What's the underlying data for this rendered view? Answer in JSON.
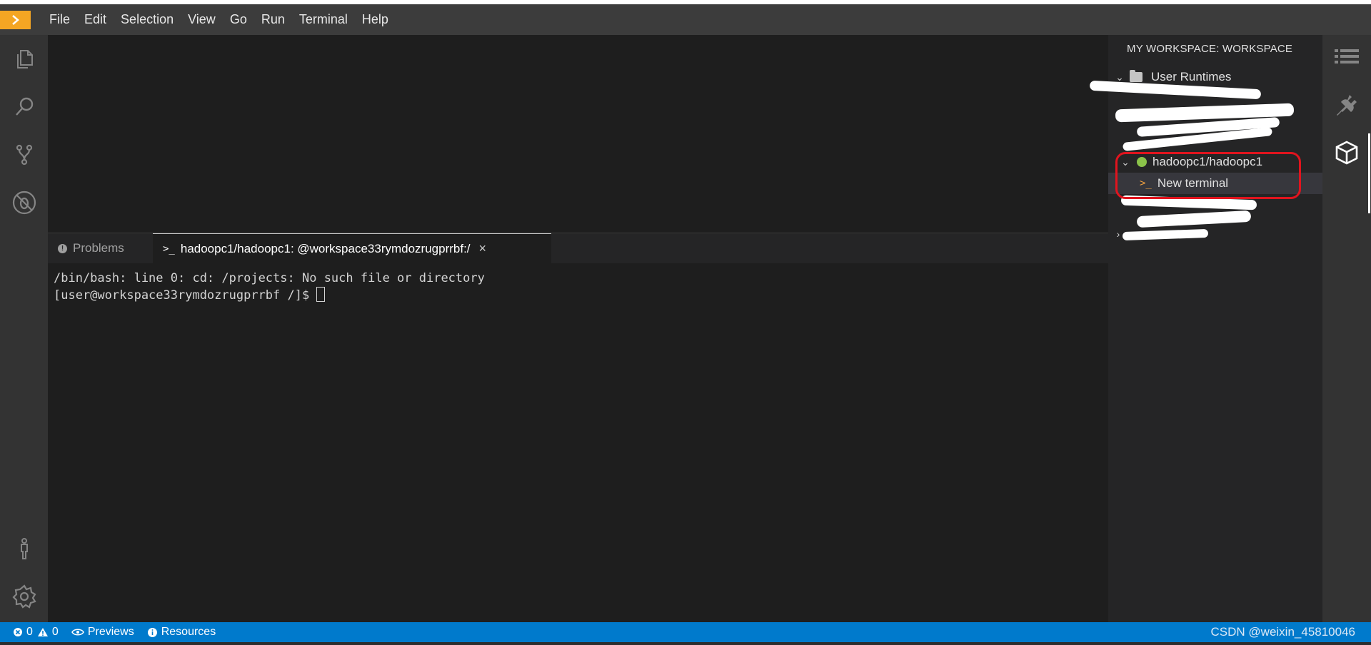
{
  "menu": {
    "items": [
      "File",
      "Edit",
      "Selection",
      "View",
      "Go",
      "Run",
      "Terminal",
      "Help"
    ]
  },
  "activity_bar": {
    "icons": [
      "files-icon",
      "search-icon",
      "source-control-icon",
      "debug-icon"
    ],
    "bottom_icons": [
      "account-icon",
      "settings-gear-icon"
    ]
  },
  "panel": {
    "problems_tab": "Problems",
    "terminal_tab": "hadoopc1/hadoopc1: @workspace33rymdozrugprrbf:/",
    "terminal_prompt_symbol": ">_",
    "close_symbol": "×",
    "terminal_lines": [
      "/bin/bash: line 0: cd: /projects: No such file or directory",
      "[user@workspace33rymdozrugprrbf /]$ "
    ]
  },
  "sidepanel": {
    "title": "MY WORKSPACE: WORKSPACE",
    "user_runtimes": "User Runtimes",
    "runtime_name": "hadoopc1/hadoopc1",
    "new_terminal": "New terminal",
    "collapsed_chevron": "›",
    "expanded_chevron": "⌄"
  },
  "statusbar": {
    "errors": "0",
    "warnings": "0",
    "previews": "Previews",
    "resources": "Resources",
    "watermark": "CSDN @weixin_45810046"
  },
  "colors": {
    "accent": "#007acc",
    "logo": "#f5a623",
    "runtime_status": "#8bc34a",
    "highlight": "#e0141e"
  }
}
